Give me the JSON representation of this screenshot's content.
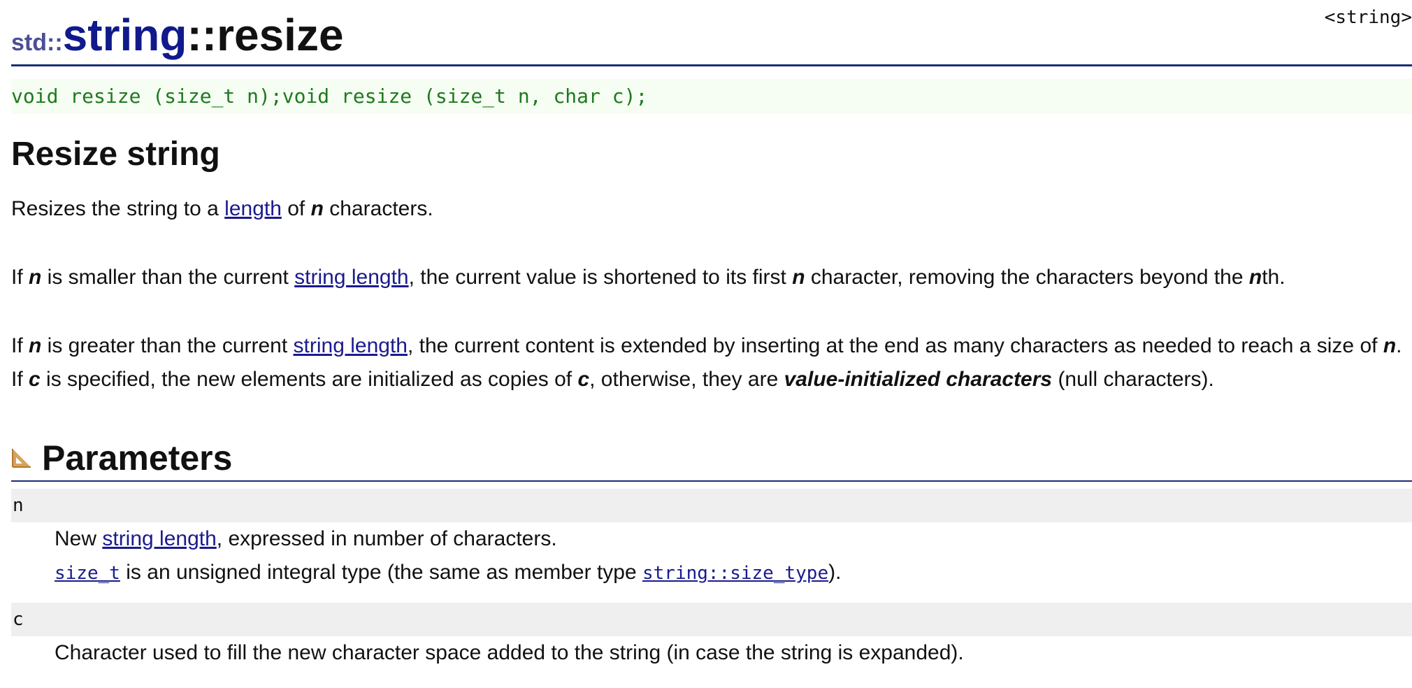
{
  "header": {
    "namespace": "std::",
    "class_name": "string",
    "separator": "::",
    "member": "resize",
    "header_file": "<string>"
  },
  "prototype": "void resize (size_t n);void resize (size_t n, char c);",
  "section_title": "Resize string",
  "para1": {
    "t1": "Resizes the string to a ",
    "link1": "length",
    "t2": " of ",
    "n": "n",
    "t3": " characters."
  },
  "para2": {
    "t1": "If ",
    "n1": "n",
    "t2": " is smaller than the current ",
    "link1": "string length",
    "t3": ", the current value is shortened to its first ",
    "n2": "n",
    "t4": " character, removing the characters beyond the ",
    "n3": "n",
    "t5": "th."
  },
  "para3": {
    "t1": "If ",
    "n1": "n",
    "t2": " is greater than the current ",
    "link1": "string length",
    "t3": ", the current content is extended by inserting at the end as many characters as needed to reach a size of ",
    "n2": "n",
    "t4": ". If ",
    "c1": "c",
    "t5": " is specified, the new elements are initialized as copies of ",
    "c2": "c",
    "t6": ", otherwise, they are ",
    "em": "value-initialized characters",
    "t7": " (null characters)."
  },
  "parameters": {
    "title": "Parameters",
    "icon": "set-square-icon",
    "icon_color": "#d9a15a",
    "n": {
      "name": "n",
      "line1_t1": "New ",
      "line1_link": "string length",
      "line1_t2": ", expressed in number of characters.",
      "line2_code_link": "size_t",
      "line2_t1": " is an unsigned integral type (the same as member type ",
      "line2_code_link2": "string::size_type",
      "line2_t2": ")."
    },
    "c": {
      "name": "c",
      "desc": "Character used to fill the new character space added to the string (in case the string is expanded)."
    }
  },
  "colors": {
    "link": "#1a1a8e",
    "class_name": "#101a8c",
    "namespace": "#4a4f96",
    "rule": "#1b2e7a",
    "prototype_text": "#1d7a1d",
    "prototype_bg": "#f6fdf3",
    "param_bg": "#efefef"
  }
}
